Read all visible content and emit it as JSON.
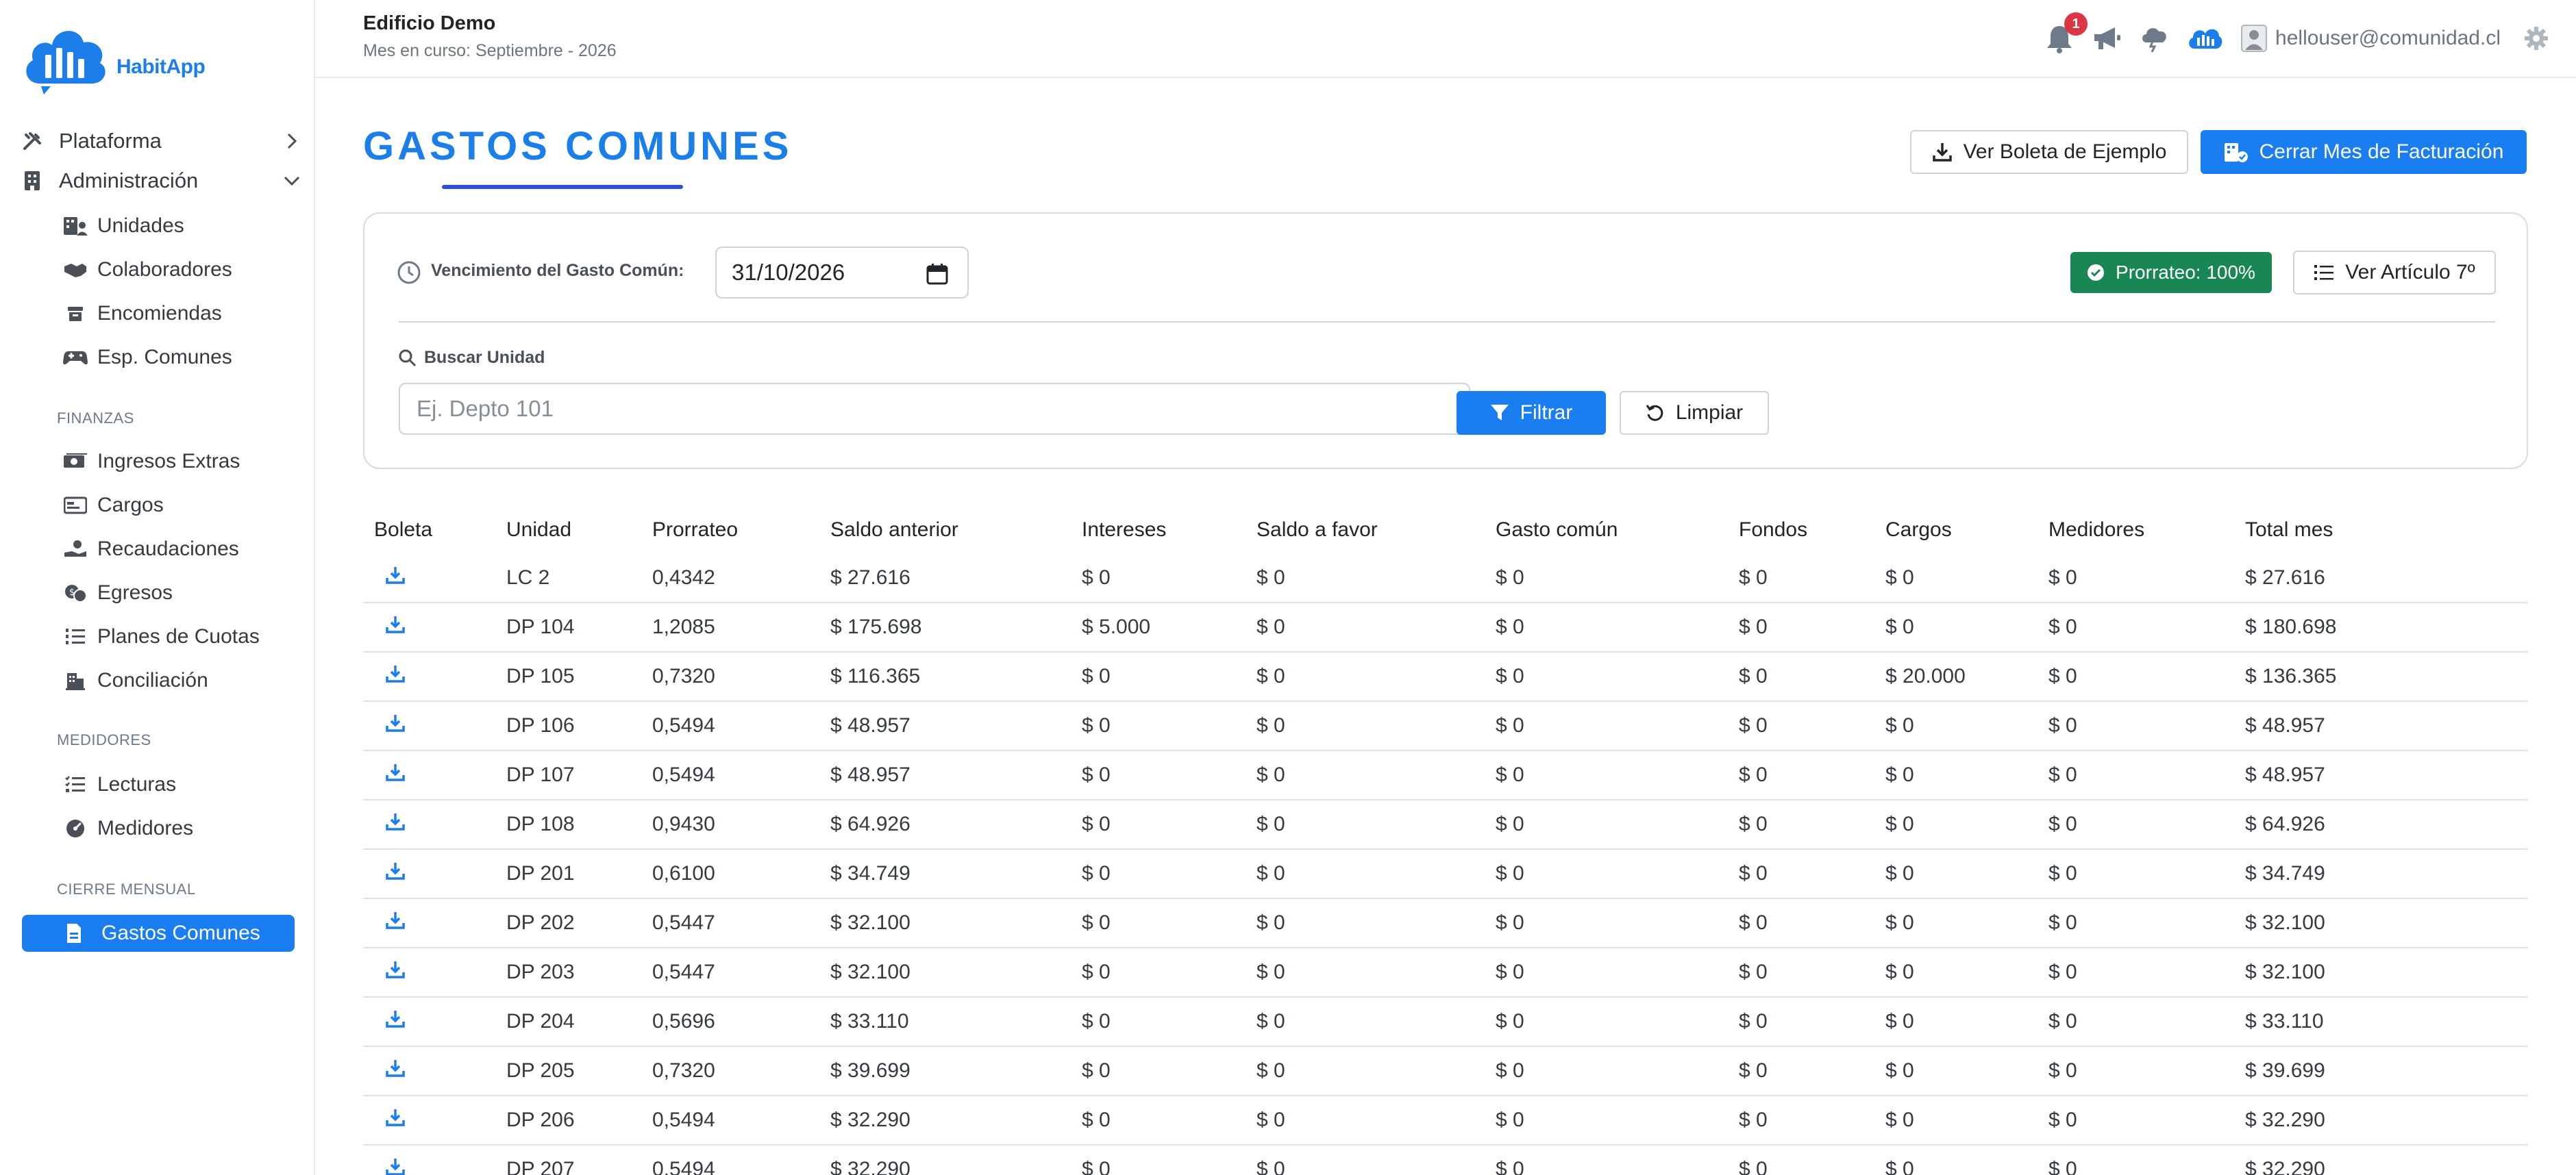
{
  "brand": {
    "name": "HabitApp",
    "color": "#1c7ee8"
  },
  "header": {
    "building_name": "Edificio Demo",
    "current_month": "Mes en curso: Septiembre - 2026",
    "notification_count": "1",
    "user_email": "hellouser@comunidad.cl",
    "icons": [
      "bell-icon",
      "megaphone-icon",
      "cloud-alert-icon",
      "habitapp-cloud-icon",
      "user-avatar-icon",
      "gear-icon"
    ]
  },
  "sidebar": {
    "top_items": [
      {
        "label": "Plataforma",
        "icon": "tools-icon",
        "expanded": false
      },
      {
        "label": "Administración",
        "icon": "building-icon",
        "expanded": true
      }
    ],
    "admin_items": [
      {
        "label": "Unidades",
        "icon": "building-user-icon"
      },
      {
        "label": "Colaboradores",
        "icon": "handshake-icon"
      },
      {
        "label": "Encomiendas",
        "icon": "package-icon"
      },
      {
        "label": "Esp. Comunes",
        "icon": "gamepad-icon"
      }
    ],
    "finanzas_title": "FINANZAS",
    "finanzas_items": [
      {
        "label": "Ingresos Extras",
        "icon": "money-bill-icon"
      },
      {
        "label": "Cargos",
        "icon": "card-icon"
      },
      {
        "label": "Recaudaciones",
        "icon": "hand-coins-icon"
      },
      {
        "label": "Egresos",
        "icon": "coins-icon"
      },
      {
        "label": "Planes de Cuotas",
        "icon": "list-ol-icon"
      },
      {
        "label": "Conciliación",
        "icon": "bank-icon"
      }
    ],
    "medidores_title": "MEDIDORES",
    "medidores_items": [
      {
        "label": "Lecturas",
        "icon": "list-check-icon"
      },
      {
        "label": "Medidores",
        "icon": "gauge-icon"
      }
    ],
    "cierre_title": "CIERRE MENSUAL",
    "active_item": {
      "label": "Gastos Comunes",
      "icon": "file-invoice-icon"
    }
  },
  "main": {
    "title": "GASTOS COMUNES",
    "btn_ver_boleta": "Ver Boleta de Ejemplo",
    "btn_cerrar_mes": "Cerrar Mes de Facturación",
    "filters": {
      "vencimiento_label": "Vencimiento del Gasto Común:",
      "vencimiento_value": "31/10/2026",
      "prorrateo_badge": "Prorrateo: 100%",
      "btn_ver_articulo": "Ver Artículo 7º",
      "buscar_label": "Buscar Unidad",
      "buscar_placeholder": "Ej. Depto 101",
      "btn_filtrar": "Filtrar",
      "btn_limpiar": "Limpiar"
    },
    "table": {
      "columns": [
        "Boleta",
        "Unidad",
        "Prorrateo",
        "Saldo anterior",
        "Intereses",
        "Saldo a favor",
        "Gasto común",
        "Fondos",
        "Cargos",
        "Medidores",
        "Total mes"
      ],
      "rows": [
        [
          "LC 2",
          "0,4342",
          "$ 27.616",
          "$ 0",
          "$ 0",
          "$ 0",
          "$ 0",
          "$ 0",
          "$ 0",
          "$ 27.616"
        ],
        [
          "DP 104",
          "1,2085",
          "$ 175.698",
          "$ 5.000",
          "$ 0",
          "$ 0",
          "$ 0",
          "$ 0",
          "$ 0",
          "$ 180.698"
        ],
        [
          "DP 105",
          "0,7320",
          "$ 116.365",
          "$ 0",
          "$ 0",
          "$ 0",
          "$ 0",
          "$ 20.000",
          "$ 0",
          "$ 136.365"
        ],
        [
          "DP 106",
          "0,5494",
          "$ 48.957",
          "$ 0",
          "$ 0",
          "$ 0",
          "$ 0",
          "$ 0",
          "$ 0",
          "$ 48.957"
        ],
        [
          "DP 107",
          "0,5494",
          "$ 48.957",
          "$ 0",
          "$ 0",
          "$ 0",
          "$ 0",
          "$ 0",
          "$ 0",
          "$ 48.957"
        ],
        [
          "DP 108",
          "0,9430",
          "$ 64.926",
          "$ 0",
          "$ 0",
          "$ 0",
          "$ 0",
          "$ 0",
          "$ 0",
          "$ 64.926"
        ],
        [
          "DP 201",
          "0,6100",
          "$ 34.749",
          "$ 0",
          "$ 0",
          "$ 0",
          "$ 0",
          "$ 0",
          "$ 0",
          "$ 34.749"
        ],
        [
          "DP 202",
          "0,5447",
          "$ 32.100",
          "$ 0",
          "$ 0",
          "$ 0",
          "$ 0",
          "$ 0",
          "$ 0",
          "$ 32.100"
        ],
        [
          "DP 203",
          "0,5447",
          "$ 32.100",
          "$ 0",
          "$ 0",
          "$ 0",
          "$ 0",
          "$ 0",
          "$ 0",
          "$ 32.100"
        ],
        [
          "DP 204",
          "0,5696",
          "$ 33.110",
          "$ 0",
          "$ 0",
          "$ 0",
          "$ 0",
          "$ 0",
          "$ 0",
          "$ 33.110"
        ],
        [
          "DP 205",
          "0,7320",
          "$ 39.699",
          "$ 0",
          "$ 0",
          "$ 0",
          "$ 0",
          "$ 0",
          "$ 0",
          "$ 39.699"
        ],
        [
          "DP 206",
          "0,5494",
          "$ 32.290",
          "$ 0",
          "$ 0",
          "$ 0",
          "$ 0",
          "$ 0",
          "$ 0",
          "$ 32.290"
        ],
        [
          "DP 207",
          "0,5494",
          "$ 32.290",
          "$ 0",
          "$ 0",
          "$ 0",
          "$ 0",
          "$ 0",
          "$ 0",
          "$ 32.290"
        ]
      ],
      "row_icon": "download-icon"
    }
  }
}
